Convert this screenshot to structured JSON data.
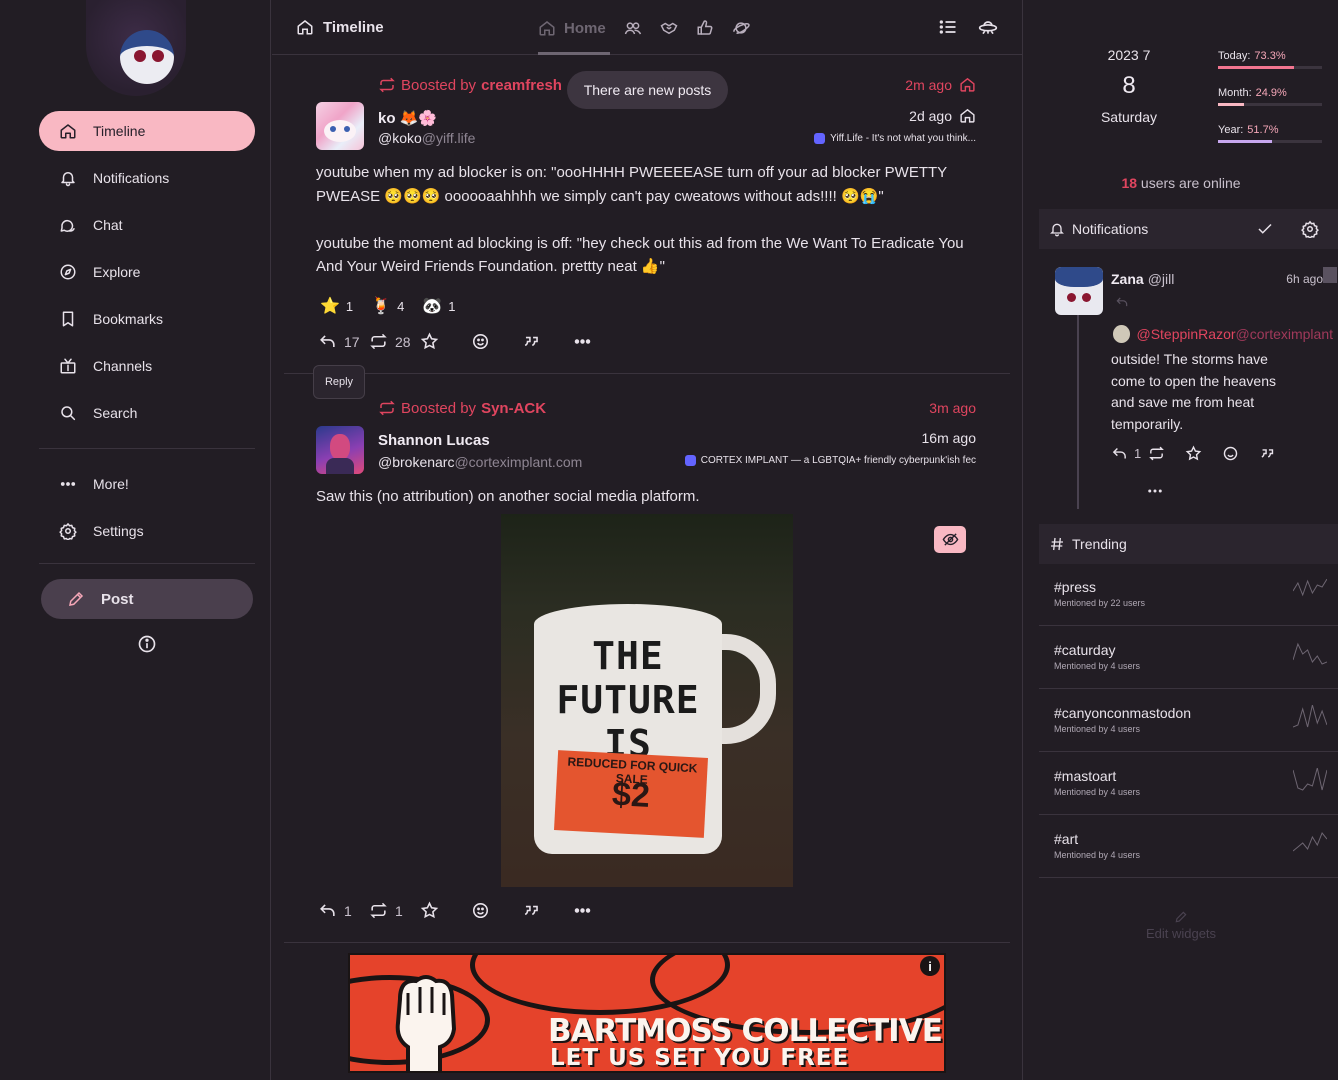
{
  "nav": {
    "items": [
      {
        "label": "Timeline",
        "icon": "home-icon"
      },
      {
        "label": "Notifications",
        "icon": "bell-icon"
      },
      {
        "label": "Chat",
        "icon": "chat-icon"
      },
      {
        "label": "Explore",
        "icon": "compass-icon"
      },
      {
        "label": "Bookmarks",
        "icon": "bookmark-icon"
      },
      {
        "label": "Channels",
        "icon": "tv-icon"
      },
      {
        "label": "Search",
        "icon": "search-icon"
      }
    ],
    "more_label": "More!",
    "settings_label": "Settings",
    "post_label": "Post"
  },
  "header": {
    "title": "Timeline",
    "home_tab": "Home",
    "new_posts_label": "There are new posts"
  },
  "posts": [
    {
      "boost_prefix": "Boosted by",
      "booster": "creamfresh",
      "boost_time": "2m ago",
      "name": "ko 🦊🌸",
      "handle_user": "@koko",
      "handle_domain": "@yiff.life",
      "time": "2d ago",
      "instance": "Yiff.Life - It's not what you think...",
      "paragraph_1": "youtube when my ad blocker is on: \"oooHHHH PWEEEEASE turn off your ad blocker PWETTY PWEASE 🥺🥺🥺 oooooaahhhh we simply can't pay cweatows without ads!!!! 🥺😭\"",
      "paragraph_2": "youtube the moment ad blocking is off: \"hey check out this ad from the We Want To Eradicate You And Your Weird Friends Foundation. prettty neat 👍\"",
      "reactions": [
        {
          "emoji": "⭐",
          "count": "1"
        },
        {
          "emoji": "🍹",
          "count": "4"
        },
        {
          "emoji": "🐼",
          "count": "1"
        }
      ],
      "replies": "17",
      "boosts": "28",
      "reply_tooltip": "Reply"
    },
    {
      "boost_prefix": "Boosted by",
      "booster": "Syn-ACK",
      "boost_time": "3m ago",
      "name": "Shannon Lucas",
      "handle_user": "@brokenarc",
      "handle_domain": "@corteximplant.com",
      "time": "16m ago",
      "instance": "CORTEX IMPLANT — a LGBTQIA+ friendly cyberpunk'ish fec",
      "paragraph_1": "Saw this (no attribution) on another social media platform.",
      "replies": "1",
      "boosts": "1",
      "image": {
        "mug_line_1": "THE",
        "mug_line_2": "FUTURE",
        "mug_line_3": "IS",
        "sticker_text": "REDUCED FOR QUICK SALE",
        "price": "$2"
      }
    }
  ],
  "banner": {
    "title": "BARTMOSS COLLECTIVE",
    "subtitle": "LET US SET YOU FREE",
    "info": "i"
  },
  "sidebar_right": {
    "date": {
      "year_month": "2023  7",
      "day": "8",
      "weekday": "Saturday"
    },
    "stats": [
      {
        "label": "Today:",
        "value": "73.3%",
        "fraction": 0.733,
        "color": "#f27590"
      },
      {
        "label": "Month:",
        "value": "24.9%",
        "fraction": 0.249,
        "color": "#f9b8c3"
      },
      {
        "label": "Year:",
        "value": "51.7%",
        "fraction": 0.517,
        "color": "#c8a8f0"
      }
    ],
    "online_count": "18",
    "online_text": "users are online",
    "notifications_title": "Notifications",
    "notification": {
      "name": "Zana",
      "handle": "@jill",
      "time": "6h ago",
      "mention_user": "@SteppinRazor",
      "mention_domain": "@corteximplant",
      "text": "outside! The storms have come to open the heavens and save me from heat temporarily.",
      "replies": "1"
    },
    "trending_title": "Trending",
    "trends": [
      {
        "tag": "#press",
        "meta": "Mentioned by 22 users",
        "spark": [
          14,
          22,
          10,
          24,
          12,
          20,
          18,
          26
        ]
      },
      {
        "tag": "#caturday",
        "meta": "Mentioned by 4 users",
        "spark": [
          8,
          24,
          14,
          18,
          6,
          12,
          4,
          6
        ]
      },
      {
        "tag": "#canyonconmastodon",
        "meta": "Mentioned by 4 users",
        "spark": [
          4,
          6,
          22,
          4,
          26,
          8,
          20,
          6
        ]
      },
      {
        "tag": "#mastoart",
        "meta": "Mentioned by 4 users",
        "spark": [
          24,
          6,
          4,
          10,
          8,
          26,
          4,
          24
        ]
      },
      {
        "tag": "#art",
        "meta": "Mentioned by 4 users",
        "spark": [
          6,
          10,
          14,
          8,
          20,
          12,
          24,
          18
        ]
      }
    ],
    "edit_widgets": "Edit widgets"
  }
}
